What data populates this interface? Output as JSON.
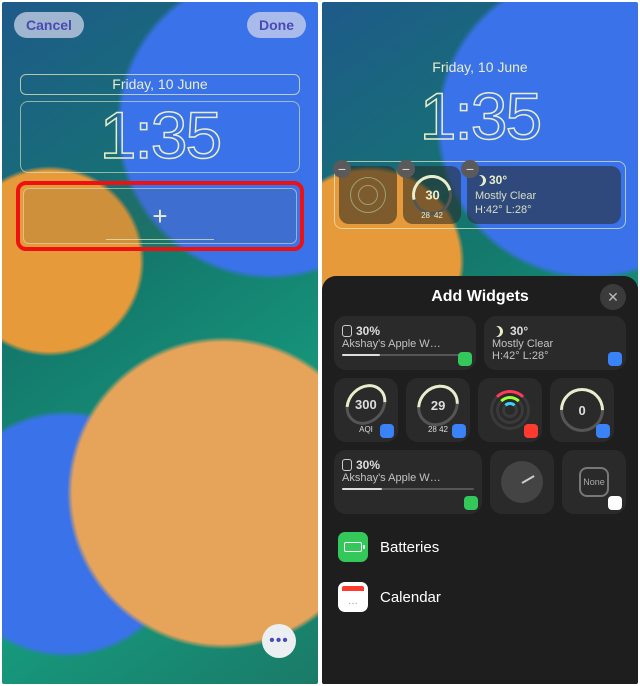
{
  "left": {
    "cancel": "Cancel",
    "done": "Done",
    "date": "Friday, 10 June",
    "time": "1:35",
    "add_plus": "+"
  },
  "right": {
    "date": "Friday, 10 June",
    "time": "1:35",
    "widgets": {
      "aqi": {
        "value": "30",
        "lo": "28",
        "hi": "42"
      },
      "weather": {
        "temp": "30°",
        "cond": "Mostly Clear",
        "hilo": "H:42° L:28°"
      }
    },
    "sheet": {
      "title": "Add Widgets",
      "cards": {
        "watch": {
          "pct": "30%",
          "label": "Akshay's Apple W…"
        },
        "weather": {
          "temp": "30°",
          "cond": "Mostly Clear",
          "hilo": "H:42° L:28°"
        },
        "aqi_big": {
          "val": "300",
          "unit": "AQI"
        },
        "aqi_sm": {
          "val": "29",
          "lo": "28",
          "hi": "42"
        },
        "uv": {
          "val": "0"
        },
        "watch2": {
          "pct": "30%",
          "label": "Akshay's Apple W…"
        },
        "none": "None"
      },
      "list": {
        "batteries": "Batteries",
        "calendar": "Calendar"
      }
    }
  }
}
